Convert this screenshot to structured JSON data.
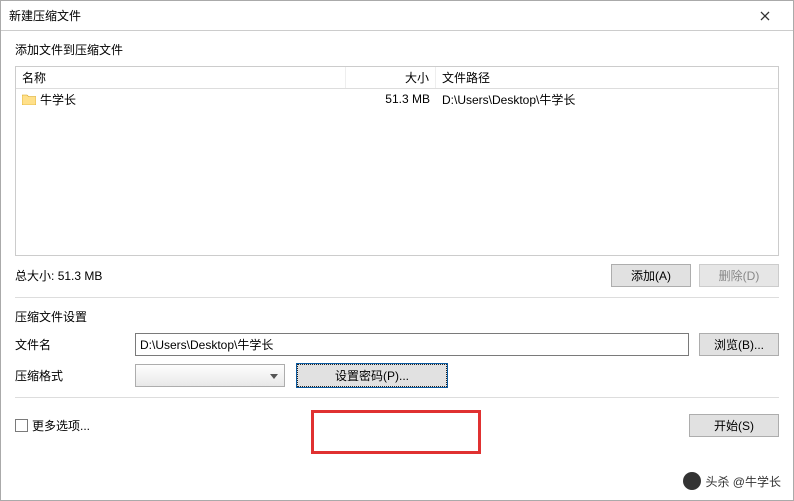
{
  "titlebar": {
    "title": "新建压缩文件"
  },
  "section1": {
    "label": "添加文件到压缩文件"
  },
  "columns": {
    "name": "名称",
    "size": "大小",
    "path": "文件路径"
  },
  "rows": [
    {
      "name": "牛学长",
      "size": "51.3 MB",
      "path": "D:\\Users\\Desktop\\牛学长"
    }
  ],
  "total": {
    "label": "总大小:",
    "value": "51.3 MB"
  },
  "buttons": {
    "add": "添加(A)",
    "remove": "删除(D)",
    "browse": "浏览(B)...",
    "set_password": "设置密码(P)...",
    "start": "开始(S)"
  },
  "section2": {
    "label": "压缩文件设置"
  },
  "fields": {
    "filename_label": "文件名",
    "filename_value": "D:\\Users\\Desktop\\牛学长",
    "format_label": "压缩格式",
    "format_value": ""
  },
  "more_options": {
    "label": "更多选项..."
  },
  "watermark": {
    "text": "头杀 @牛学长"
  }
}
